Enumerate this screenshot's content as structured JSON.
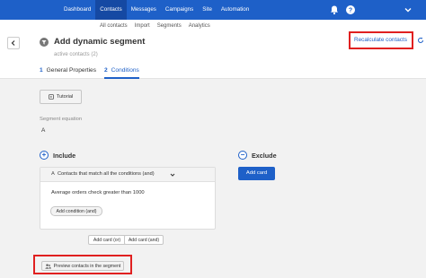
{
  "topnav": {
    "items": [
      "Dashboard",
      "Contacts",
      "Messages",
      "Campaigns",
      "Site",
      "Automation"
    ],
    "active": "Contacts"
  },
  "topbar_icons": [
    "bell-icon",
    "help-icon",
    "account-menu-icon"
  ],
  "subnav": {
    "items": [
      "All contacts",
      "Import",
      "Segments",
      "Analytics"
    ]
  },
  "header": {
    "title": "Add dynamic segment",
    "subtitle": "active contacts (2)",
    "recalculate_label": "Recalculate contacts"
  },
  "tabs": [
    {
      "num": "1",
      "label": "General Properties"
    },
    {
      "num": "2",
      "label": "Conditions"
    }
  ],
  "active_tab": "Conditions",
  "tutorial_label": "Tutorial",
  "segment_equation": {
    "label": "Segment equation",
    "value": "A"
  },
  "include": {
    "title": "Include",
    "card": {
      "letter": "A",
      "match_label": "Contacts that match all the conditions (and)",
      "condition": "Average orders check greater than 1000",
      "add_condition_label": "Add condition (and)"
    },
    "add_card_or": "Add card (or)",
    "add_card_and": "Add card (and)"
  },
  "exclude": {
    "title": "Exclude",
    "add_card_label": "Add card"
  },
  "preview_label": "Preview contacts in the segment",
  "colors": {
    "brand": "#1e60c8",
    "highlight": "#e02020"
  }
}
